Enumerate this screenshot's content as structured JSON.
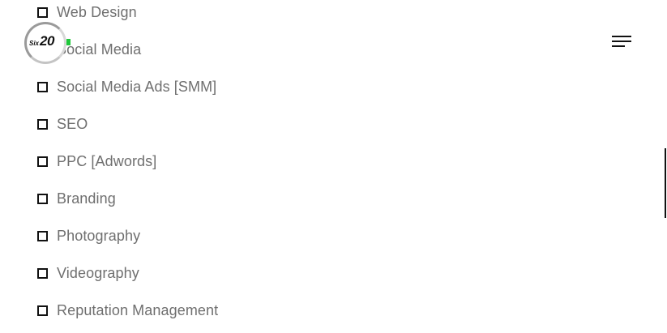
{
  "header": {
    "logo": {
      "small_text": "Six",
      "big_text": "20",
      "accent_color": "#1ec83a"
    },
    "menu_icon": "hamburger-menu-icon"
  },
  "services": [
    {
      "label": "Web Design"
    },
    {
      "label": "Social Media"
    },
    {
      "label": "Social Media Ads [SMM]"
    },
    {
      "label": "SEO"
    },
    {
      "label": "PPC [Adwords]"
    },
    {
      "label": "Branding"
    },
    {
      "label": "Photography"
    },
    {
      "label": "Videography"
    },
    {
      "label": "Reputation Management"
    }
  ],
  "colors": {
    "text": "#6f6f6f",
    "checkbox_border": "#111111",
    "background": "#ffffff"
  }
}
